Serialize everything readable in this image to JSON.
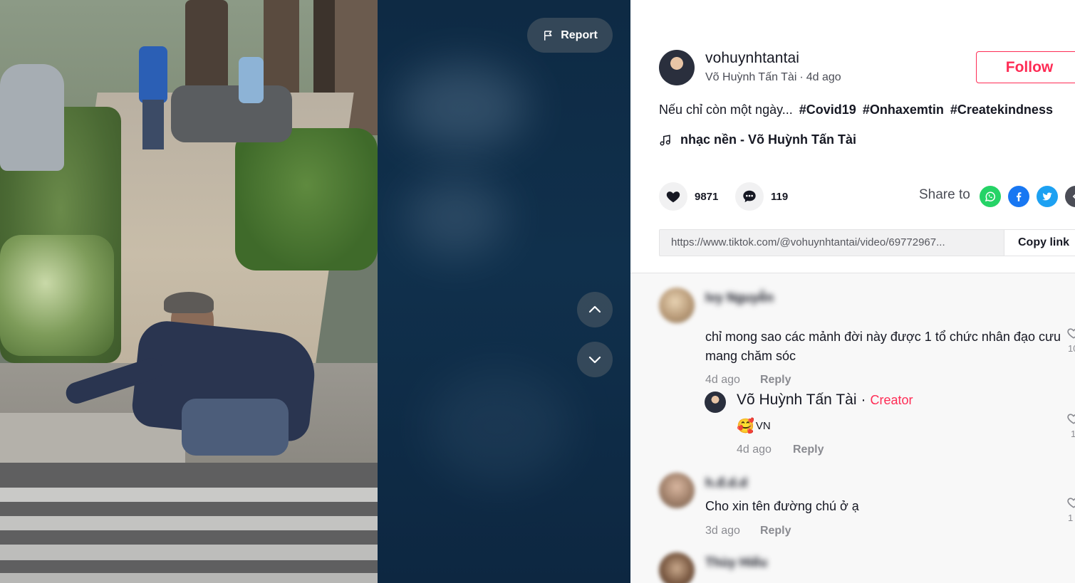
{
  "video": {
    "report_label": "Report",
    "icons": {
      "report": "flag-icon",
      "previous": "chevron-up-icon",
      "next": "chevron-down-icon"
    }
  },
  "author": {
    "username": "vohuynhtantai",
    "display_name": "Võ Huỳnh Tấn Tài",
    "separator": "·",
    "posted": "4d ago",
    "follow_label": "Follow"
  },
  "post": {
    "caption": "Nếu chỉ còn một ngày...",
    "hashtags": [
      "#Covid19",
      "#Onhaxemtin",
      "#Createkindness"
    ],
    "music": "nhạc nền - Võ Huỳnh Tấn Tài",
    "likes": "9871",
    "comments_count": "119",
    "share_label": "Share to",
    "share_targets": [
      "whatsapp-icon",
      "facebook-icon",
      "twitter-icon",
      "more-share-icon"
    ],
    "link": "https://www.tiktok.com/@vohuynhtantai/video/69772967...",
    "copy_link_label": "Copy link"
  },
  "comments": [
    {
      "name": "Ivy Nguyễn",
      "text": "chỉ mong sao các mảnh đời này được 1 tổ chức nhân đạo cưu mang chăm sóc",
      "time": "4d ago",
      "reply_label": "Reply",
      "likes": "10"
    },
    {
      "name": "Võ Huỳnh Tấn Tài",
      "creator_label": "Creator",
      "separator": "·",
      "text": "VN",
      "emoji": "🥰",
      "time": "4d ago",
      "reply_label": "Reply",
      "likes": "1"
    },
    {
      "name": "h.đ.d.d",
      "text": "Cho xin tên đường chú ở ạ",
      "time": "3d ago",
      "reply_label": "Reply",
      "likes": "1"
    },
    {
      "name": "Thùy Hiếu",
      "text": "",
      "time": "",
      "reply_label": "",
      "likes": ""
    }
  ],
  "colors": {
    "accent": "#fe2c55",
    "whatsapp": "#25d366",
    "facebook": "#1877f2",
    "twitter": "#1da1f2",
    "video_background": "#0e2a44"
  }
}
